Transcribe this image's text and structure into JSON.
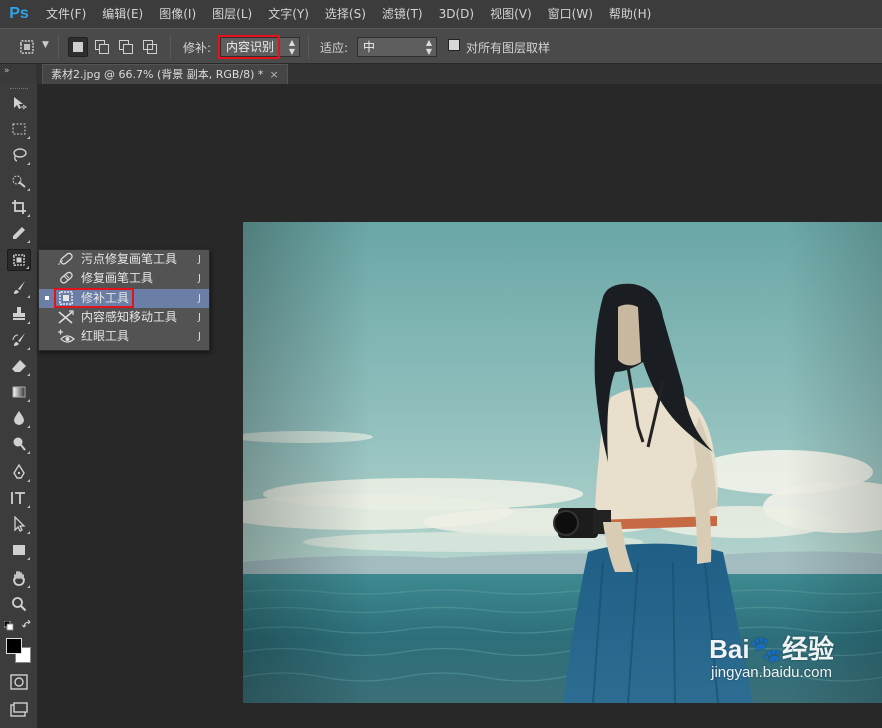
{
  "app": {
    "logo": "Ps"
  },
  "menu": [
    "文件(F)",
    "编辑(E)",
    "图像(I)",
    "图层(L)",
    "文字(Y)",
    "选择(S)",
    "滤镜(T)",
    "3D(D)",
    "视图(V)",
    "窗口(W)",
    "帮助(H)"
  ],
  "options": {
    "patch_label": "修补:",
    "patch_value": "内容识别",
    "adapt_label": "适应:",
    "adapt_value": "中",
    "sample_all_label": "对所有图层取样",
    "sample_all_checked": false
  },
  "document": {
    "tab_title": "素材2.jpg @ 66.7% (背景 副本, RGB/8) *",
    "close": "×"
  },
  "flyout": [
    {
      "label": "污点修复画笔工具",
      "key": "J",
      "icon": "spot-healing-brush-icon",
      "selected": false
    },
    {
      "label": "修复画笔工具",
      "key": "J",
      "icon": "healing-brush-icon",
      "selected": false
    },
    {
      "label": "修补工具",
      "key": "J",
      "icon": "patch-icon",
      "selected": true
    },
    {
      "label": "内容感知移动工具",
      "key": "J",
      "icon": "content-aware-move-icon",
      "selected": false
    },
    {
      "label": "红眼工具",
      "key": "J",
      "icon": "red-eye-icon",
      "selected": false
    }
  ],
  "watermark": {
    "logo": "Bai🐾经验",
    "url": "jingyan.baidu.com"
  },
  "colors": {
    "highlight": "#e3131b",
    "selection": "#6b7ea6",
    "foreground": "#000000",
    "background": "#ffffff"
  }
}
